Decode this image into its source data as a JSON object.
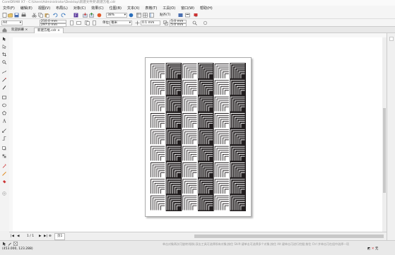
{
  "title": "CorelDRAW X7 - C:\\Users\\Administrator\\Desktop\\新建文件夹\\新建方框.cdr",
  "menu": [
    "文件(F)",
    "编辑(E)",
    "视图(V)",
    "布局(L)",
    "对象(C)",
    "效果(C)",
    "位图(B)",
    "文本(X)",
    "表格(T)",
    "工具(O)",
    "窗口(W)",
    "帮助(H)"
  ],
  "toolbar": {
    "zoom": "38%",
    "snap_label": "贴齐(T)"
  },
  "propbar": {
    "page_size": "A4",
    "width": "210.0 mm",
    "height": "297.0 mm",
    "units_label": "单位:",
    "units": "毫米",
    "nudge": "0.1 mm",
    "dup_x": "5.0 mm",
    "dup_y": "5.0 mm"
  },
  "tabs": [
    "欢迎屏幕",
    "新建方框.cdr"
  ],
  "pager": {
    "current": "1 / 1",
    "page_tab": "页1"
  },
  "status": {
    "coords": "(453.000, 123.288)",
    "hint": "单击对象两次可旋转/倾斜;双击工具可选择所有对象;按住 Shift 键单击可选择多个对象;按住 Alt 键单击可进行挖掘;按住 Ctrl 并单击可在组中选择一项",
    "fill": "无"
  },
  "colors": {
    "accent": "#2a6ebb",
    "dark_column": "#231f20",
    "light_column": "#ffffff"
  },
  "icons": [
    "new-icon",
    "open-icon",
    "save-icon",
    "print-icon",
    "undo-icon",
    "redo-icon",
    "import-icon",
    "export-icon",
    "zoom-icon",
    "pick-tool-icon",
    "shape-tool-icon",
    "crop-icon",
    "zoom-tool-icon",
    "freehand-icon",
    "rectangle-icon",
    "ellipse-icon",
    "polygon-icon",
    "text-icon",
    "dimension-icon",
    "connector-icon",
    "drop-shadow-icon",
    "eyedropper-icon",
    "fill-icon",
    "outline-icon"
  ]
}
